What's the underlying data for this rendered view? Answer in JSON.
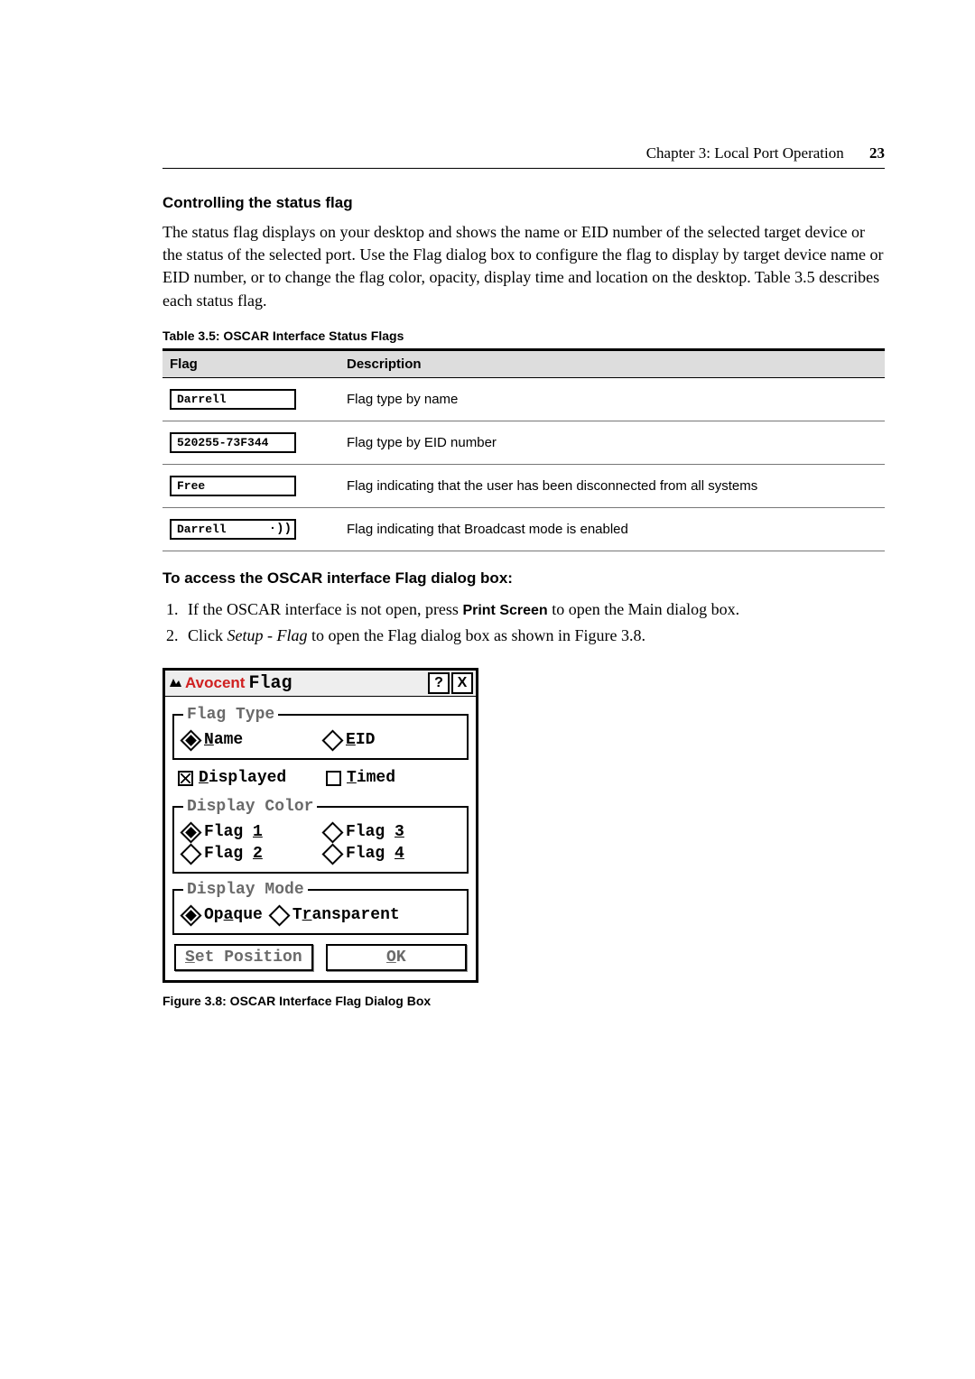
{
  "header": {
    "chapter": "Chapter 3: Local Port Operation",
    "page": "23"
  },
  "sec1": {
    "title": "Controlling the status flag",
    "para": "The status flag displays on your desktop and shows the name or EID number of the selected target device or the status of the selected port. Use the Flag dialog box to configure the flag to display by target device name or EID number, or to change the flag color, opacity, display time and location on the desktop. Table 3.5 describes each status flag."
  },
  "table": {
    "caption": "Table 3.5: OSCAR Interface Status Flags",
    "headers": {
      "h1": "Flag",
      "h2": "Description"
    },
    "rows": [
      {
        "flag": "Darrell",
        "bcast": "",
        "desc": "Flag type by name"
      },
      {
        "flag": "520255-73F344",
        "bcast": "",
        "desc": "Flag type by EID number"
      },
      {
        "flag": "Free",
        "bcast": "",
        "desc": "Flag indicating that the user has been disconnected from all systems"
      },
      {
        "flag": "Darrell",
        "bcast": "·))",
        "desc": "Flag indicating that Broadcast mode is enabled"
      }
    ]
  },
  "sec2": {
    "title": "To access the OSCAR interface Flag dialog box:",
    "steps": {
      "s1a": "If the OSCAR interface is not open, press ",
      "s1b": "Print Screen",
      "s1c": " to open the Main dialog box.",
      "s2a": "Click ",
      "s2b": "Setup - Flag",
      "s2c": " to open the Flag dialog box as shown in Figure 3.8."
    }
  },
  "dialog": {
    "brand": "Avocent",
    "title": "Flag",
    "help": "?",
    "close": "X",
    "flag_type": {
      "legend": "Flag Type",
      "name_u": "N",
      "name_rest": "ame",
      "eid_u": "E",
      "eid_rest": "ID"
    },
    "displayed_u": "D",
    "displayed_rest": "isplayed",
    "timed_u": "T",
    "timed_rest": "imed",
    "display_color": {
      "legend": "Display Color",
      "f1a": "Flag ",
      "f1u": "1",
      "f3a": "Flag ",
      "f3u": "3",
      "f2a": "Flag ",
      "f2u": "2",
      "f4a": "Flag ",
      "f4u": "4"
    },
    "display_mode": {
      "legend": "Display Mode",
      "opaque_a": "Op",
      "opaque_u": "a",
      "opaque_b": "que",
      "trans_a": "T",
      "trans_u": "r",
      "trans_b": "ansparent"
    },
    "setpos_u": "S",
    "setpos_rest": "et Position",
    "ok_u": "O",
    "ok_rest": "K"
  },
  "fig_caption": "Figure 3.8: OSCAR Interface Flag Dialog Box"
}
